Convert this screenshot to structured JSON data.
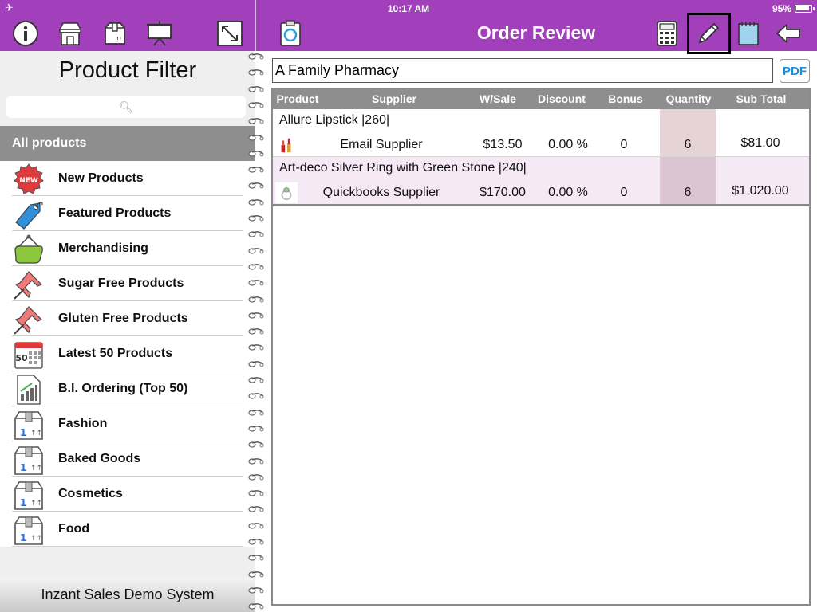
{
  "status": {
    "time": "10:17 AM",
    "battery": "95%"
  },
  "header": {
    "title": "Order Review"
  },
  "sidebar": {
    "title": "Product Filter",
    "search_placeholder": "",
    "all_label": "All products",
    "items": [
      {
        "label": "New Products",
        "icon": "new-badge-icon"
      },
      {
        "label": "Featured Products",
        "icon": "price-tag-icon"
      },
      {
        "label": "Merchandising",
        "icon": "hanging-sign-icon"
      },
      {
        "label": "Sugar Free Products",
        "icon": "pushpin-icon"
      },
      {
        "label": "Gluten Free Products",
        "icon": "pushpin-icon"
      },
      {
        "label": "Latest 50 Products",
        "icon": "calendar-50-icon"
      },
      {
        "label": "B.I. Ordering (Top 50)",
        "icon": "bar-chart-icon"
      },
      {
        "label": "Fashion",
        "icon": "box-icon"
      },
      {
        "label": "Baked Goods",
        "icon": "box-icon"
      },
      {
        "label": "Cosmetics",
        "icon": "box-icon"
      },
      {
        "label": "Food",
        "icon": "box-icon"
      }
    ],
    "footer": "Inzant Sales Demo System"
  },
  "order": {
    "customer": "A Family Pharmacy",
    "pdf_label": "PDF",
    "columns": [
      "Product",
      "Supplier",
      "W/Sale",
      "Discount",
      "Bonus",
      "Quantity",
      "Sub Total"
    ],
    "lines": [
      {
        "product": "Allure Lipstick |260|",
        "supplier": "Email Supplier",
        "wsale": "$13.50",
        "discount": "0.00 %",
        "bonus": "0",
        "quantity": "6",
        "subtotal": "$81.00"
      },
      {
        "product": "Art-deco Silver Ring with Green Stone |240|",
        "supplier": "Quickbooks Supplier",
        "wsale": "$170.00",
        "discount": "0.00 %",
        "bonus": "0",
        "quantity": "6",
        "subtotal": "$1,020.00"
      }
    ]
  },
  "colors": {
    "brand": "#a23fba",
    "header_gray": "#8e8e8e",
    "qty_bg": "#e5d3d5",
    "alt_row": "#f5e9f6"
  }
}
